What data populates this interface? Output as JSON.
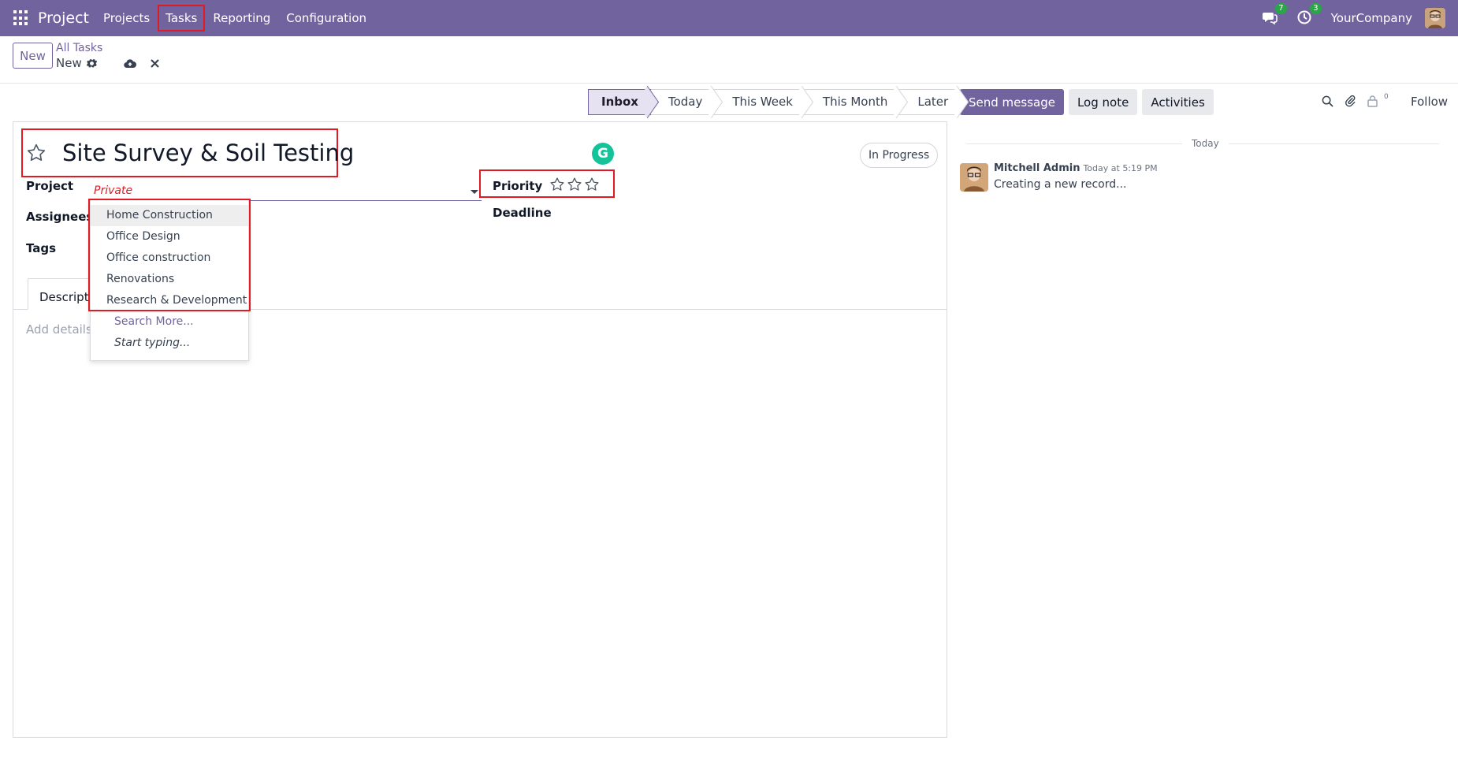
{
  "navbar": {
    "brand": "Project",
    "menu": [
      "Projects",
      "Tasks",
      "Reporting",
      "Configuration"
    ],
    "messages_count": "7",
    "activities_count": "3",
    "company": "YourCompany"
  },
  "control": {
    "new_label": "New",
    "breadcrumb_parent": "All Tasks",
    "breadcrumb_current": "New"
  },
  "statusbar": {
    "stages": [
      "Inbox",
      "Today",
      "This Week",
      "This Month",
      "Later",
      "..."
    ],
    "active": "Inbox"
  },
  "form": {
    "title": "Site Survey & Soil Testing",
    "status": "In Progress",
    "grammarly_letter": "G",
    "labels": {
      "project": "Project",
      "assignees": "Assignees",
      "tags": "Tags",
      "priority": "Priority",
      "deadline": "Deadline"
    },
    "project_value": "Private",
    "priority_stars": 3,
    "priority_level": 0,
    "tab_description": "Descriptio",
    "description_placeholder": "Add details a"
  },
  "dropdown": {
    "options": [
      "Home Construction",
      "Office Design",
      "Office construction",
      "Renovations",
      "Research & Development"
    ],
    "search_more": "Search More...",
    "start_typing": "Start typing..."
  },
  "chatter": {
    "send_message": "Send message",
    "log_note": "Log note",
    "activities": "Activities",
    "followers_count": "0",
    "follow": "Follow",
    "date_separator": "Today",
    "message": {
      "author": "Mitchell Admin",
      "time": "Today at 5:19 PM",
      "body": "Creating a new record..."
    }
  }
}
